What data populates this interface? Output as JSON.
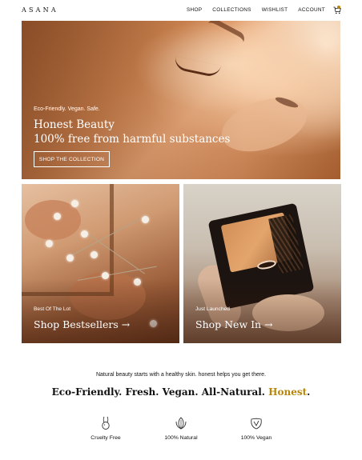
{
  "header": {
    "logo": "ASANA",
    "nav": [
      "SHOP",
      "COLLECTIONS",
      "WISHLIST",
      "ACCOUNT"
    ]
  },
  "hero": {
    "tagline": "Eco-Friendly. Vegan. Safe.",
    "title_line1": "Honest Beauty",
    "title_line2": "100% free from harmful substances",
    "button_label": "SHOP THE COLLECTION"
  },
  "tiles": [
    {
      "kicker": "Best Of The Lot",
      "title": "Shop Bestsellers →"
    },
    {
      "kicker": "Just Launched",
      "title": "Shop New In →"
    }
  ],
  "intro": {
    "lead": "Natural beauty starts with a healthy skin. honest helps you get there.",
    "headline_main": "Eco-Friendly. Fresh. Vegan. All-Natural. ",
    "headline_accent": "Honest",
    "headline_end": "."
  },
  "features": [
    {
      "label": "Cruelty Free",
      "icon": "rabbit-icon"
    },
    {
      "label": "100% Natural",
      "icon": "leaf-icon"
    },
    {
      "label": "100% Vegan",
      "icon": "vegan-leaf-icon"
    }
  ],
  "colors": {
    "accent": "#b8860b",
    "text": "#111111"
  }
}
